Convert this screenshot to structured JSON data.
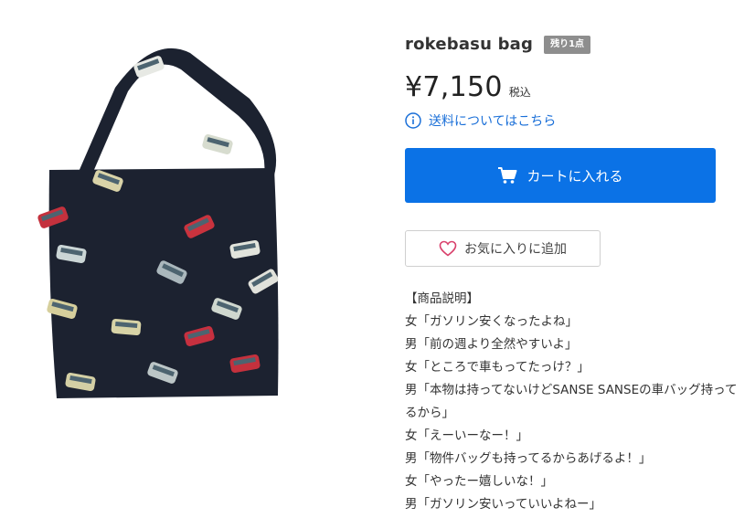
{
  "product": {
    "title": "rokebasu bag",
    "stock_badge": "残り1点",
    "price": "¥7,150",
    "tax_label": "税込",
    "image_alt": "rokebasu bag tote with bus and car print"
  },
  "shipping": {
    "link_label": "送料についてはこちら",
    "icon": "info-circle-icon"
  },
  "actions": {
    "cart_label": "カートに入れる",
    "cart_icon": "cart-icon",
    "favorite_label": "お気に入りに追加",
    "favorite_icon": "heart-icon"
  },
  "description": {
    "heading": "【商品説明】",
    "lines": [
      "女「ガソリン安くなったよね」",
      "男「前の週より全然やすいよ」",
      "女「ところで車もってたっけ？」",
      "男「本物は持ってないけどSANSE SANSEの車バッグ持ってるから」",
      "女「えーいーなー！」",
      "男「物件バッグも持ってるからあげるよ！」",
      "女「やったー嬉しいな！」",
      "男「ガソリン安いっていいよねー」"
    ]
  },
  "colors": {
    "accent": "#0b72e6",
    "link": "#1a6fd8",
    "badge": "#8e8e8e",
    "bag": "#1c2230",
    "heart": "#d9406b"
  }
}
